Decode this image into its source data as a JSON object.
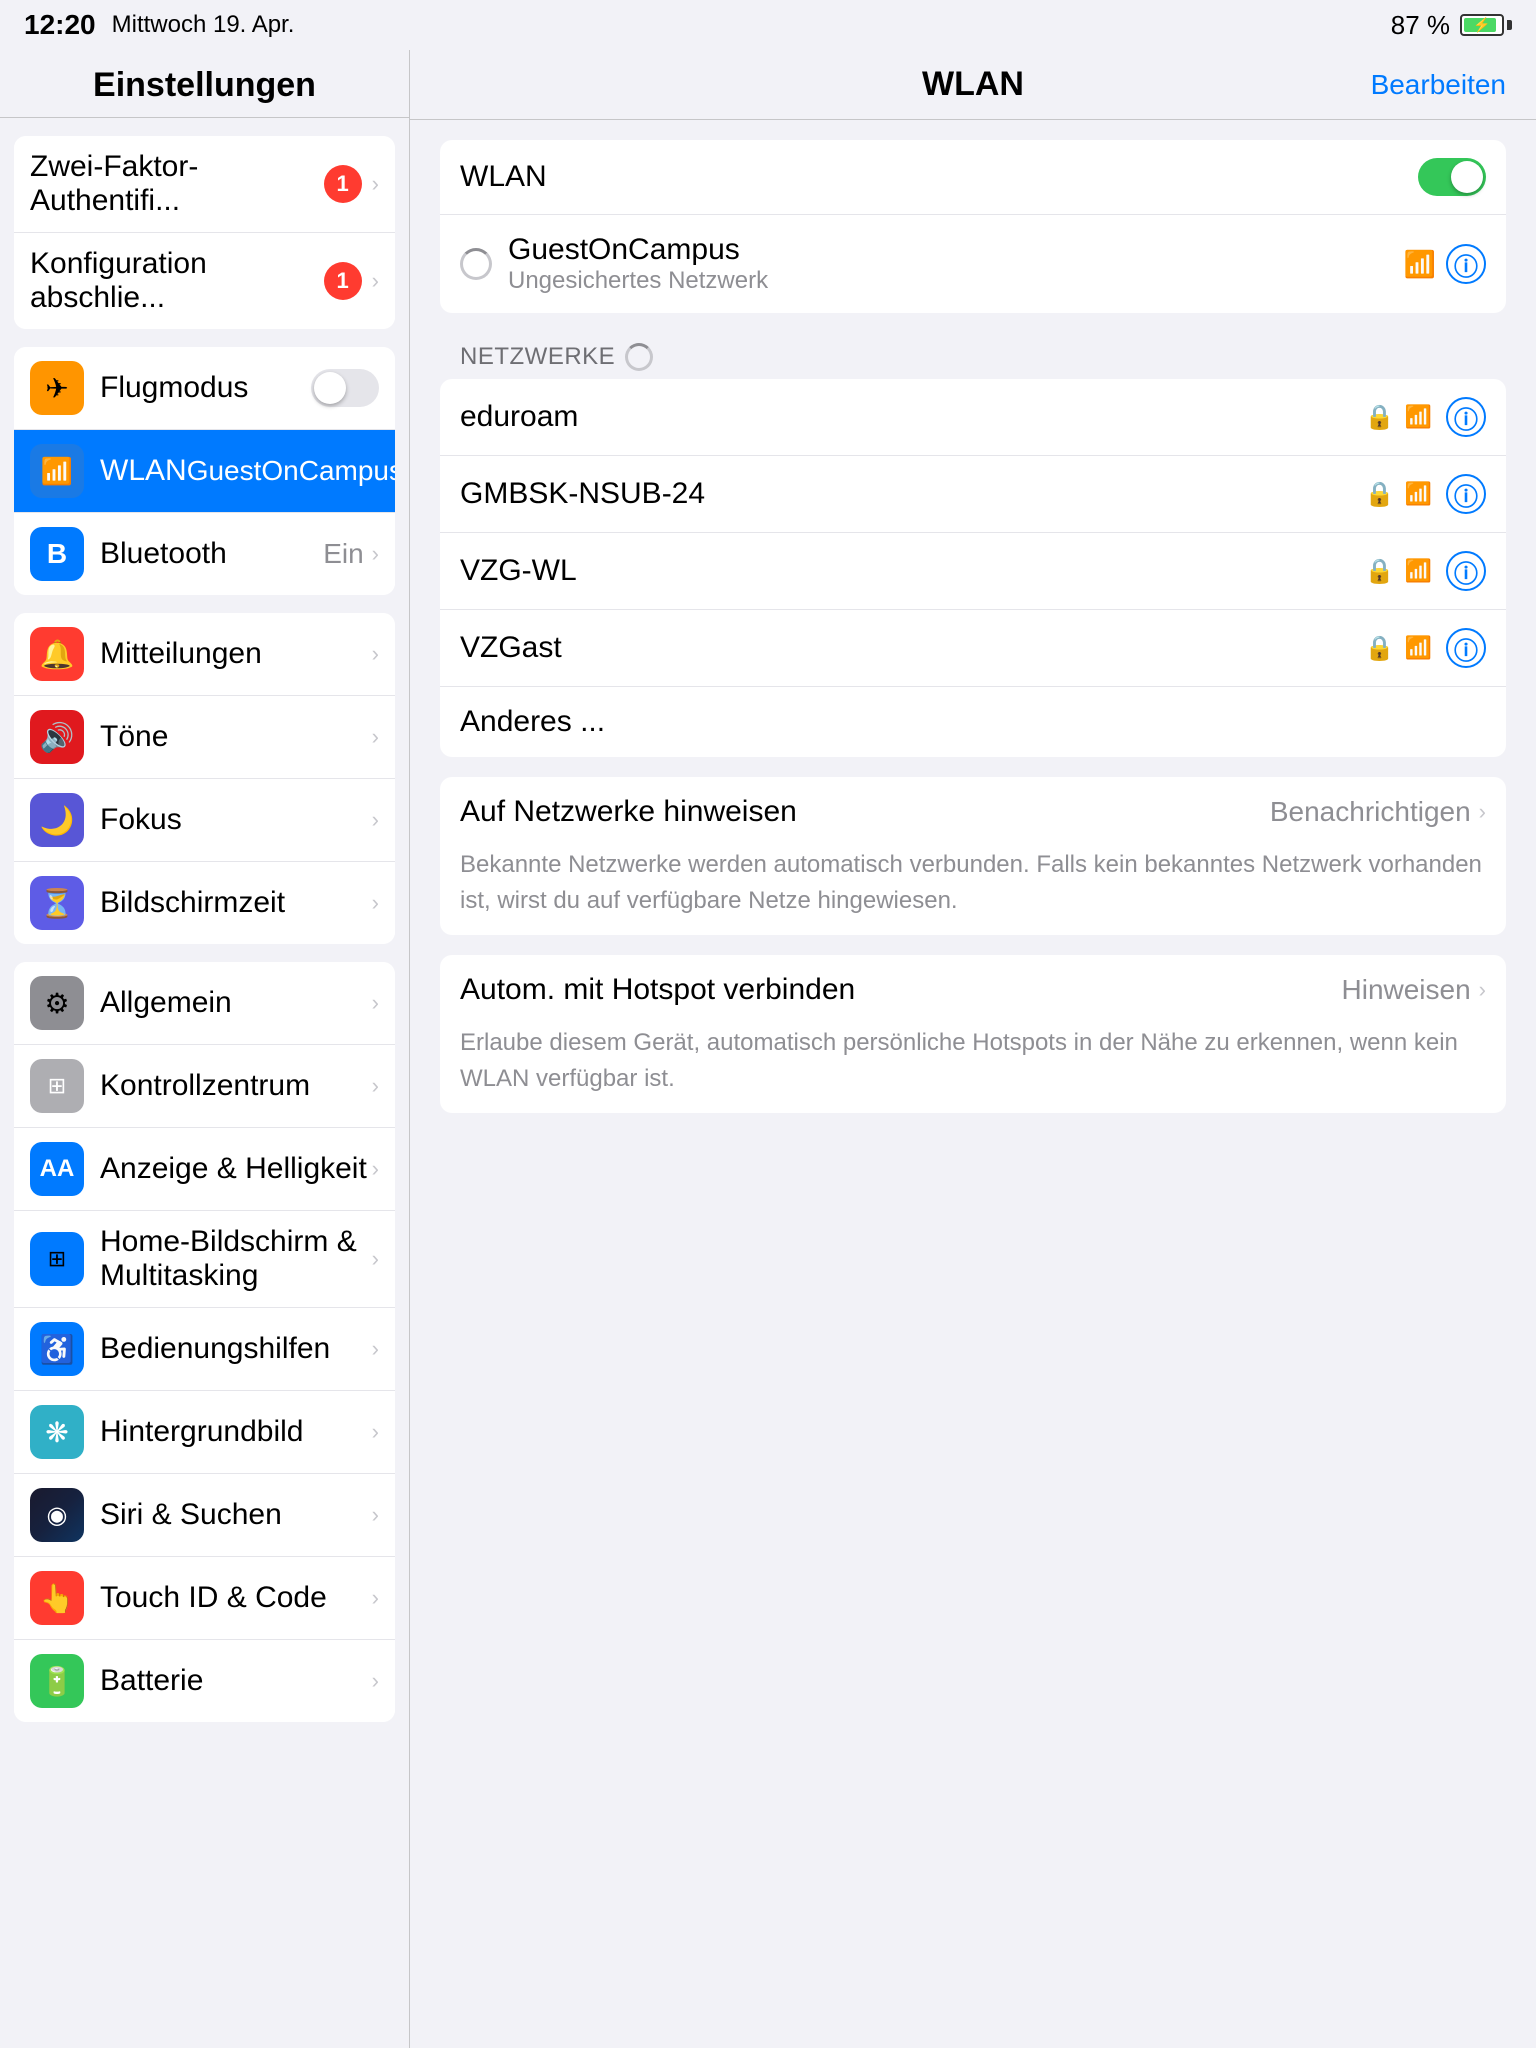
{
  "statusBar": {
    "time": "12:20",
    "day": "Mittwoch 19. Apr.",
    "battery": "87 %"
  },
  "sidebar": {
    "title": "Einstellungen",
    "groups": [
      {
        "items": [
          {
            "id": "zwei-faktor",
            "label": "Zwei-Faktor-Authentifi...",
            "badge": "1",
            "icon": null,
            "hasChevron": true
          },
          {
            "id": "konfiguration",
            "label": "Konfiguration abschlie...",
            "badge": "1",
            "icon": null,
            "hasChevron": true
          }
        ]
      },
      {
        "items": [
          {
            "id": "flugmodus",
            "label": "Flugmodus",
            "iconColor": "orange",
            "iconSymbol": "✈",
            "hasToggle": true,
            "toggleState": "off"
          },
          {
            "id": "wlan",
            "label": "WLAN",
            "value": "GuestOnCampus",
            "iconColor": "blue",
            "iconSymbol": "wifi",
            "active": true,
            "hasChevron": true
          },
          {
            "id": "bluetooth",
            "label": "Bluetooth",
            "value": "Ein",
            "iconColor": "blue",
            "iconSymbol": "bt",
            "hasChevron": true
          }
        ]
      },
      {
        "items": [
          {
            "id": "mitteilungen",
            "label": "Mitteilungen",
            "iconColor": "red",
            "iconSymbol": "🔔",
            "hasChevron": true
          },
          {
            "id": "toene",
            "label": "Töne",
            "iconColor": "red-dark",
            "iconSymbol": "🔊",
            "hasChevron": true
          },
          {
            "id": "fokus",
            "label": "Fokus",
            "iconColor": "purple",
            "iconSymbol": "🌙",
            "hasChevron": true
          },
          {
            "id": "bildschirmzeit",
            "label": "Bildschirmzeit",
            "iconColor": "purple-dark",
            "iconSymbol": "⏳",
            "hasChevron": true
          }
        ]
      },
      {
        "items": [
          {
            "id": "allgemein",
            "label": "Allgemein",
            "iconColor": "gray",
            "iconSymbol": "⚙",
            "hasChevron": true
          },
          {
            "id": "kontrollzentrum",
            "label": "Kontrollzentrum",
            "iconColor": "gray2",
            "iconSymbol": "⊞",
            "hasChevron": true
          },
          {
            "id": "anzeige",
            "label": "Anzeige & Helligkeit",
            "iconColor": "blue",
            "iconSymbol": "AA",
            "hasChevron": true
          },
          {
            "id": "home-bildschirm",
            "label": "Home-Bildschirm & Multitasking",
            "iconColor": "multitask",
            "iconSymbol": "⊞",
            "hasChevron": true
          },
          {
            "id": "bedienungshilfen",
            "label": "Bedienungshilfen",
            "iconColor": "blue",
            "iconSymbol": "♿",
            "hasChevron": true
          },
          {
            "id": "hintergrundbild",
            "label": "Hintergrundbild",
            "iconColor": "teal",
            "iconSymbol": "❋",
            "hasChevron": true
          },
          {
            "id": "siri",
            "label": "Siri & Suchen",
            "iconColor": "siri",
            "iconSymbol": "◉",
            "hasChevron": true
          },
          {
            "id": "touchid",
            "label": "Touch ID & Code",
            "iconColor": "touchid",
            "iconSymbol": "👆",
            "hasChevron": true
          },
          {
            "id": "batterie",
            "label": "Batterie",
            "iconColor": "green",
            "iconSymbol": "🔋",
            "hasChevron": true
          }
        ]
      }
    ]
  },
  "rightPanel": {
    "title": "WLAN",
    "editButton": "Bearbeiten",
    "wlanToggleLabel": "WLAN",
    "wlanToggleState": "on",
    "connectedNetwork": {
      "name": "GuestOnCampus",
      "sublabel": "Ungesichertes Netzwerk"
    },
    "sectionLabel": "NETZWERKE",
    "networks": [
      {
        "name": "eduroam",
        "locked": true
      },
      {
        "name": "GMBSK-NSUB-24",
        "locked": true
      },
      {
        "name": "VZG-WL",
        "locked": true
      },
      {
        "name": "VZGast",
        "locked": true
      },
      {
        "name": "Anderes ...",
        "locked": false
      }
    ],
    "notifyCard": {
      "label": "Auf Netzwerke hinweisen",
      "value": "Benachrichtigen",
      "description": "Bekannte Netzwerke werden automatisch verbunden. Falls kein bekanntes Netzwerk vorhanden ist, wirst du auf verfügbare Netze hingewiesen."
    },
    "hotspotCard": {
      "label": "Autom. mit Hotspot verbinden",
      "value": "Hinweisen",
      "description": "Erlaube diesem Gerät, automatisch persönliche Hotspots in der Nähe zu erkennen, wenn kein WLAN verfügbar ist."
    }
  }
}
